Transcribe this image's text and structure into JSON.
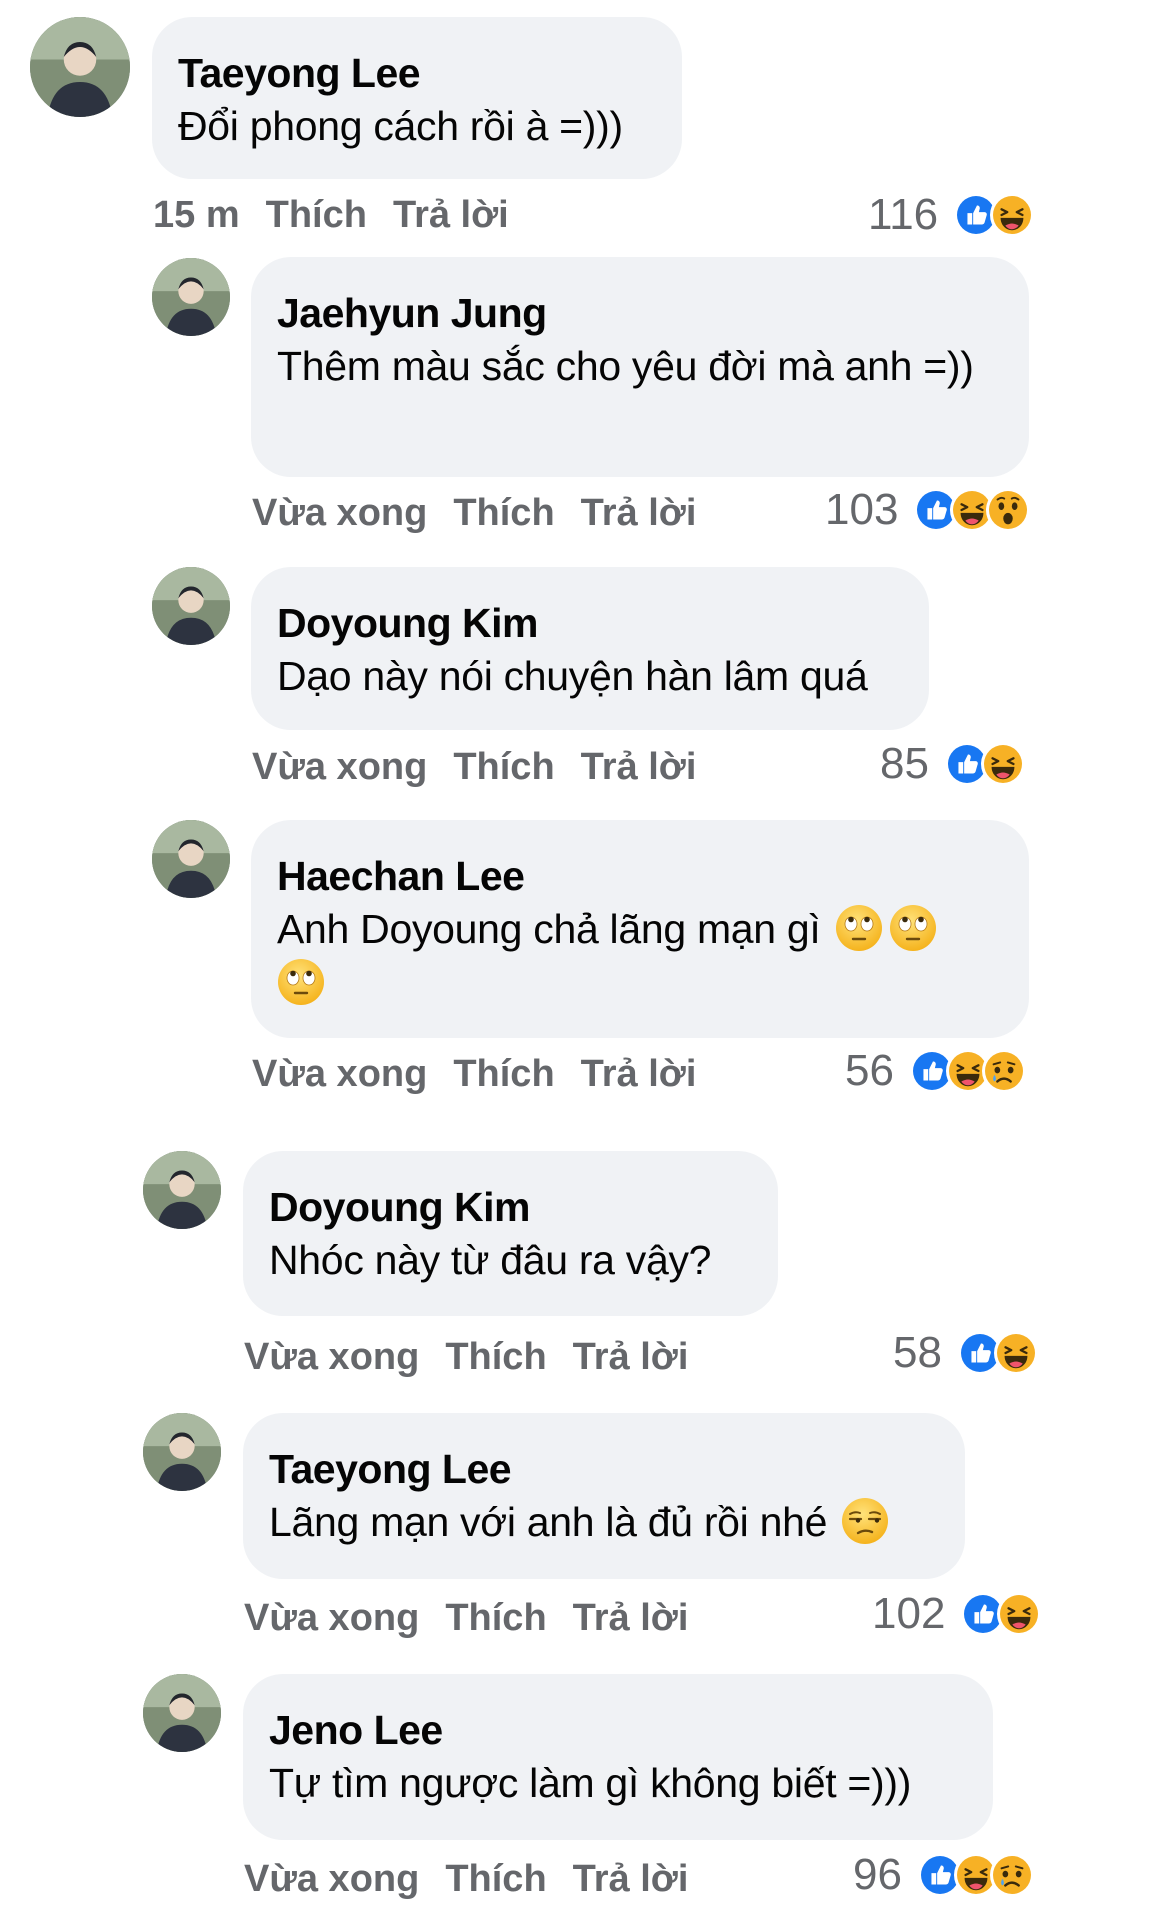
{
  "actions": {
    "like_label": "Thích",
    "reply_label": "Trả lời"
  },
  "colors": {
    "bubble": "#f0f2f5",
    "meta_text": "#65676b",
    "like_blue": "#1877f2",
    "haha_yellow": "#f7b125"
  },
  "comments": [
    {
      "author": "Taeyong Lee",
      "text": "Đổi phong cách rồi à =)))",
      "time": "15 m",
      "reaction_count": "116",
      "reactions": [
        "like-icon",
        "haha-icon"
      ]
    },
    {
      "author": "Jaehyun Jung",
      "text": "Thêm màu sắc cho yêu đời mà anh =))",
      "time": "Vừa xong",
      "reaction_count": "103",
      "reactions": [
        "like-icon",
        "haha-icon",
        "wow-icon"
      ]
    },
    {
      "author": "Doyoung Kim",
      "text": "Dạo này nói chuyện hàn lâm quá",
      "time": "Vừa xong",
      "reaction_count": "85",
      "reactions": [
        "like-icon",
        "haha-icon"
      ]
    },
    {
      "author": "Haechan Lee",
      "text": "Anh Doyoung chả lãng mạn gì",
      "emojis": [
        "face-with-rolling-eyes",
        "face-with-rolling-eyes",
        "face-with-rolling-eyes"
      ],
      "time": "Vừa xong",
      "reaction_count": "56",
      "reactions": [
        "like-icon",
        "haha-icon",
        "sad-icon"
      ]
    },
    {
      "author": "Doyoung Kim",
      "text": "Nhóc này từ đâu ra vậy?",
      "time": "Vừa xong",
      "reaction_count": "58",
      "reactions": [
        "like-icon",
        "haha-icon"
      ]
    },
    {
      "author": "Taeyong Lee",
      "text": "Lãng mạn với anh là đủ rồi nhé",
      "emojis": [
        "unamused-face"
      ],
      "time": "Vừa xong",
      "reaction_count": "102",
      "reactions": [
        "like-icon",
        "haha-icon"
      ]
    },
    {
      "author": "Jeno Lee",
      "text": "Tự tìm ngược làm gì không biết =)))",
      "time": "Vừa xong",
      "reaction_count": "96",
      "reactions": [
        "like-icon",
        "haha-icon",
        "sad-icon"
      ]
    }
  ]
}
